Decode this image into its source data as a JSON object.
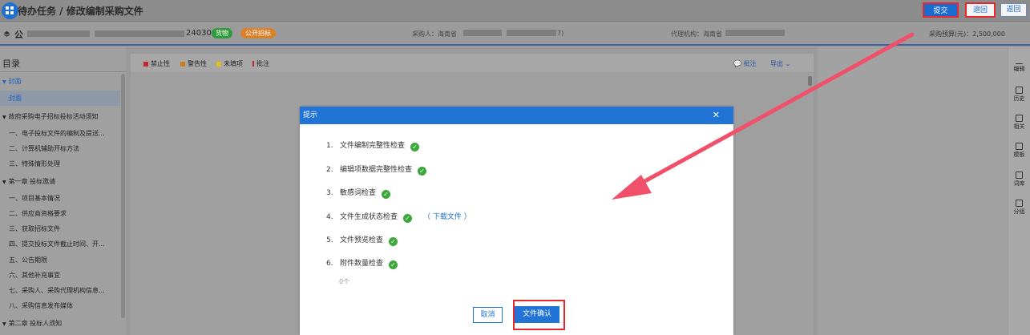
{
  "header": {
    "title": "待办任务 / 修改编制采购文件",
    "submit_label": "提交",
    "back_label": "退回",
    "return_label": "返回"
  },
  "info": {
    "project_name_prefix": "公",
    "project_code_suffix": "24030",
    "tag_goods": "货物",
    "tag_open_tender": "公开招标",
    "purchaser": "采购人：海南省",
    "purchaser_suffix": "7)",
    "agency": "代理机构：海南省",
    "budget": "采购预算(元)：2,500,000"
  },
  "toc": {
    "title": "目录",
    "items": [
      {
        "label": "封面",
        "level": "l1",
        "expanded": true
      },
      {
        "label": "封面",
        "level": "sub",
        "selected": true
      },
      {
        "label": "政府采购电子招标投标活动须知",
        "level": "l1",
        "expanded": true
      },
      {
        "label": "一、电子投标文件的编制及提送...",
        "level": "sub"
      },
      {
        "label": "二、计算机辅助开标方法",
        "level": "sub"
      },
      {
        "label": "三、特殊情形处理",
        "level": "sub"
      },
      {
        "label": "第一章 投标邀请",
        "level": "l1",
        "expanded": true
      },
      {
        "label": "一、项目基本情况",
        "level": "sub"
      },
      {
        "label": "二、供应商资格要求",
        "level": "sub"
      },
      {
        "label": "三、获取招标文件",
        "level": "sub"
      },
      {
        "label": "四、提交投标文件截止时间、开...",
        "level": "sub"
      },
      {
        "label": "五、公告期限",
        "level": "sub"
      },
      {
        "label": "六、其他补充事宜",
        "level": "sub"
      },
      {
        "label": "七、采购人、采购代理机构信息...",
        "level": "sub"
      },
      {
        "label": "八、采购信息发布媒体",
        "level": "sub"
      },
      {
        "label": "第二章 投标人须知",
        "level": "l1",
        "expanded": true
      }
    ]
  },
  "doc_toolbar": {
    "legend_forbidden": "禁止性",
    "legend_warning": "警告性",
    "legend_unfilled": "未填项",
    "legend_comment": "批注",
    "comment_button": "批注",
    "export_button": "导出"
  },
  "right_tools": [
    "编辑",
    "历史",
    "相关",
    "模板",
    "词库",
    "分组"
  ],
  "modal": {
    "title": "提示",
    "checks": [
      {
        "num": "1.",
        "label": "文件编制完整性检查"
      },
      {
        "num": "2.",
        "label": "编辑项数据完整性检查"
      },
      {
        "num": "3.",
        "label": "敏感词检查"
      },
      {
        "num": "4.",
        "label": "文件生成状态检查",
        "link": "（ 下载文件 ）"
      },
      {
        "num": "5.",
        "label": "文件预览检查"
      },
      {
        "num": "6.",
        "label": "附件数量检查"
      }
    ],
    "attachment_count": "0个",
    "cancel_label": "取消",
    "confirm_label": "文件确认"
  },
  "colors": {
    "accent": "#2173d6",
    "highlight_red": "#e8262e",
    "ok_green": "#3aa83a",
    "tag_goods": "#2f9b3c",
    "tag_open": "#d9802a"
  }
}
